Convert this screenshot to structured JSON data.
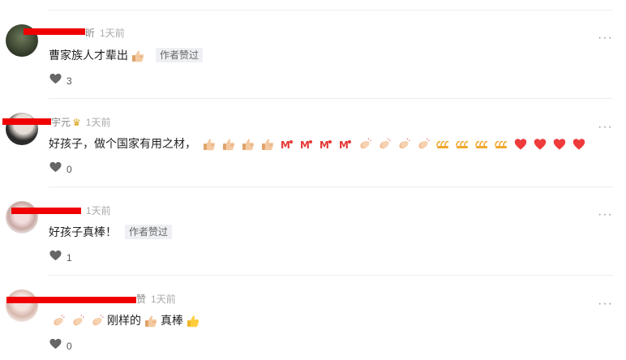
{
  "comments": [
    {
      "name_visible": "昕",
      "time": "1天前",
      "text": "曹家族人才辈出",
      "after_emojis": [
        "thumbs-up"
      ],
      "badge": "作者赞过",
      "likes": "3"
    },
    {
      "name_visible": "宇元",
      "crown": true,
      "time": "1天前",
      "text": "好孩子，做个国家有用之材，",
      "after_emojis": [
        "thumbs-up",
        "thumbs-up",
        "thumbs-up",
        "thumbs-up",
        "cheer-text",
        "cheer-text",
        "cheer-text",
        "cheer-text",
        "clap",
        "clap",
        "clap",
        "clap",
        "666-text",
        "666-text",
        "666-text",
        "666-text",
        "heart",
        "heart",
        "heart",
        "heart"
      ],
      "badge": "",
      "likes": "0"
    },
    {
      "name_visible": "",
      "time": "1天前",
      "text": "好孩子真棒！",
      "after_emojis": [],
      "badge": "作者赞过",
      "likes": "1"
    },
    {
      "name_visible": "",
      "name_tail": "赞",
      "time": "1天前",
      "before_emojis": [
        "clap",
        "clap",
        "clap"
      ],
      "text": "刚样的",
      "after_emojis": [
        "thumbs-up"
      ],
      "text2": "真棒",
      "after_emojis2": [
        "thumbs-up-yellow"
      ],
      "badge": "",
      "likes": "0"
    }
  ],
  "icons": {
    "like": "heart-icon",
    "more": "more-icon"
  },
  "more_glyph": "···",
  "colors": {
    "redaction": "#f00000",
    "badge_bg": "#eef0f4",
    "heart_icon": "#666666"
  }
}
